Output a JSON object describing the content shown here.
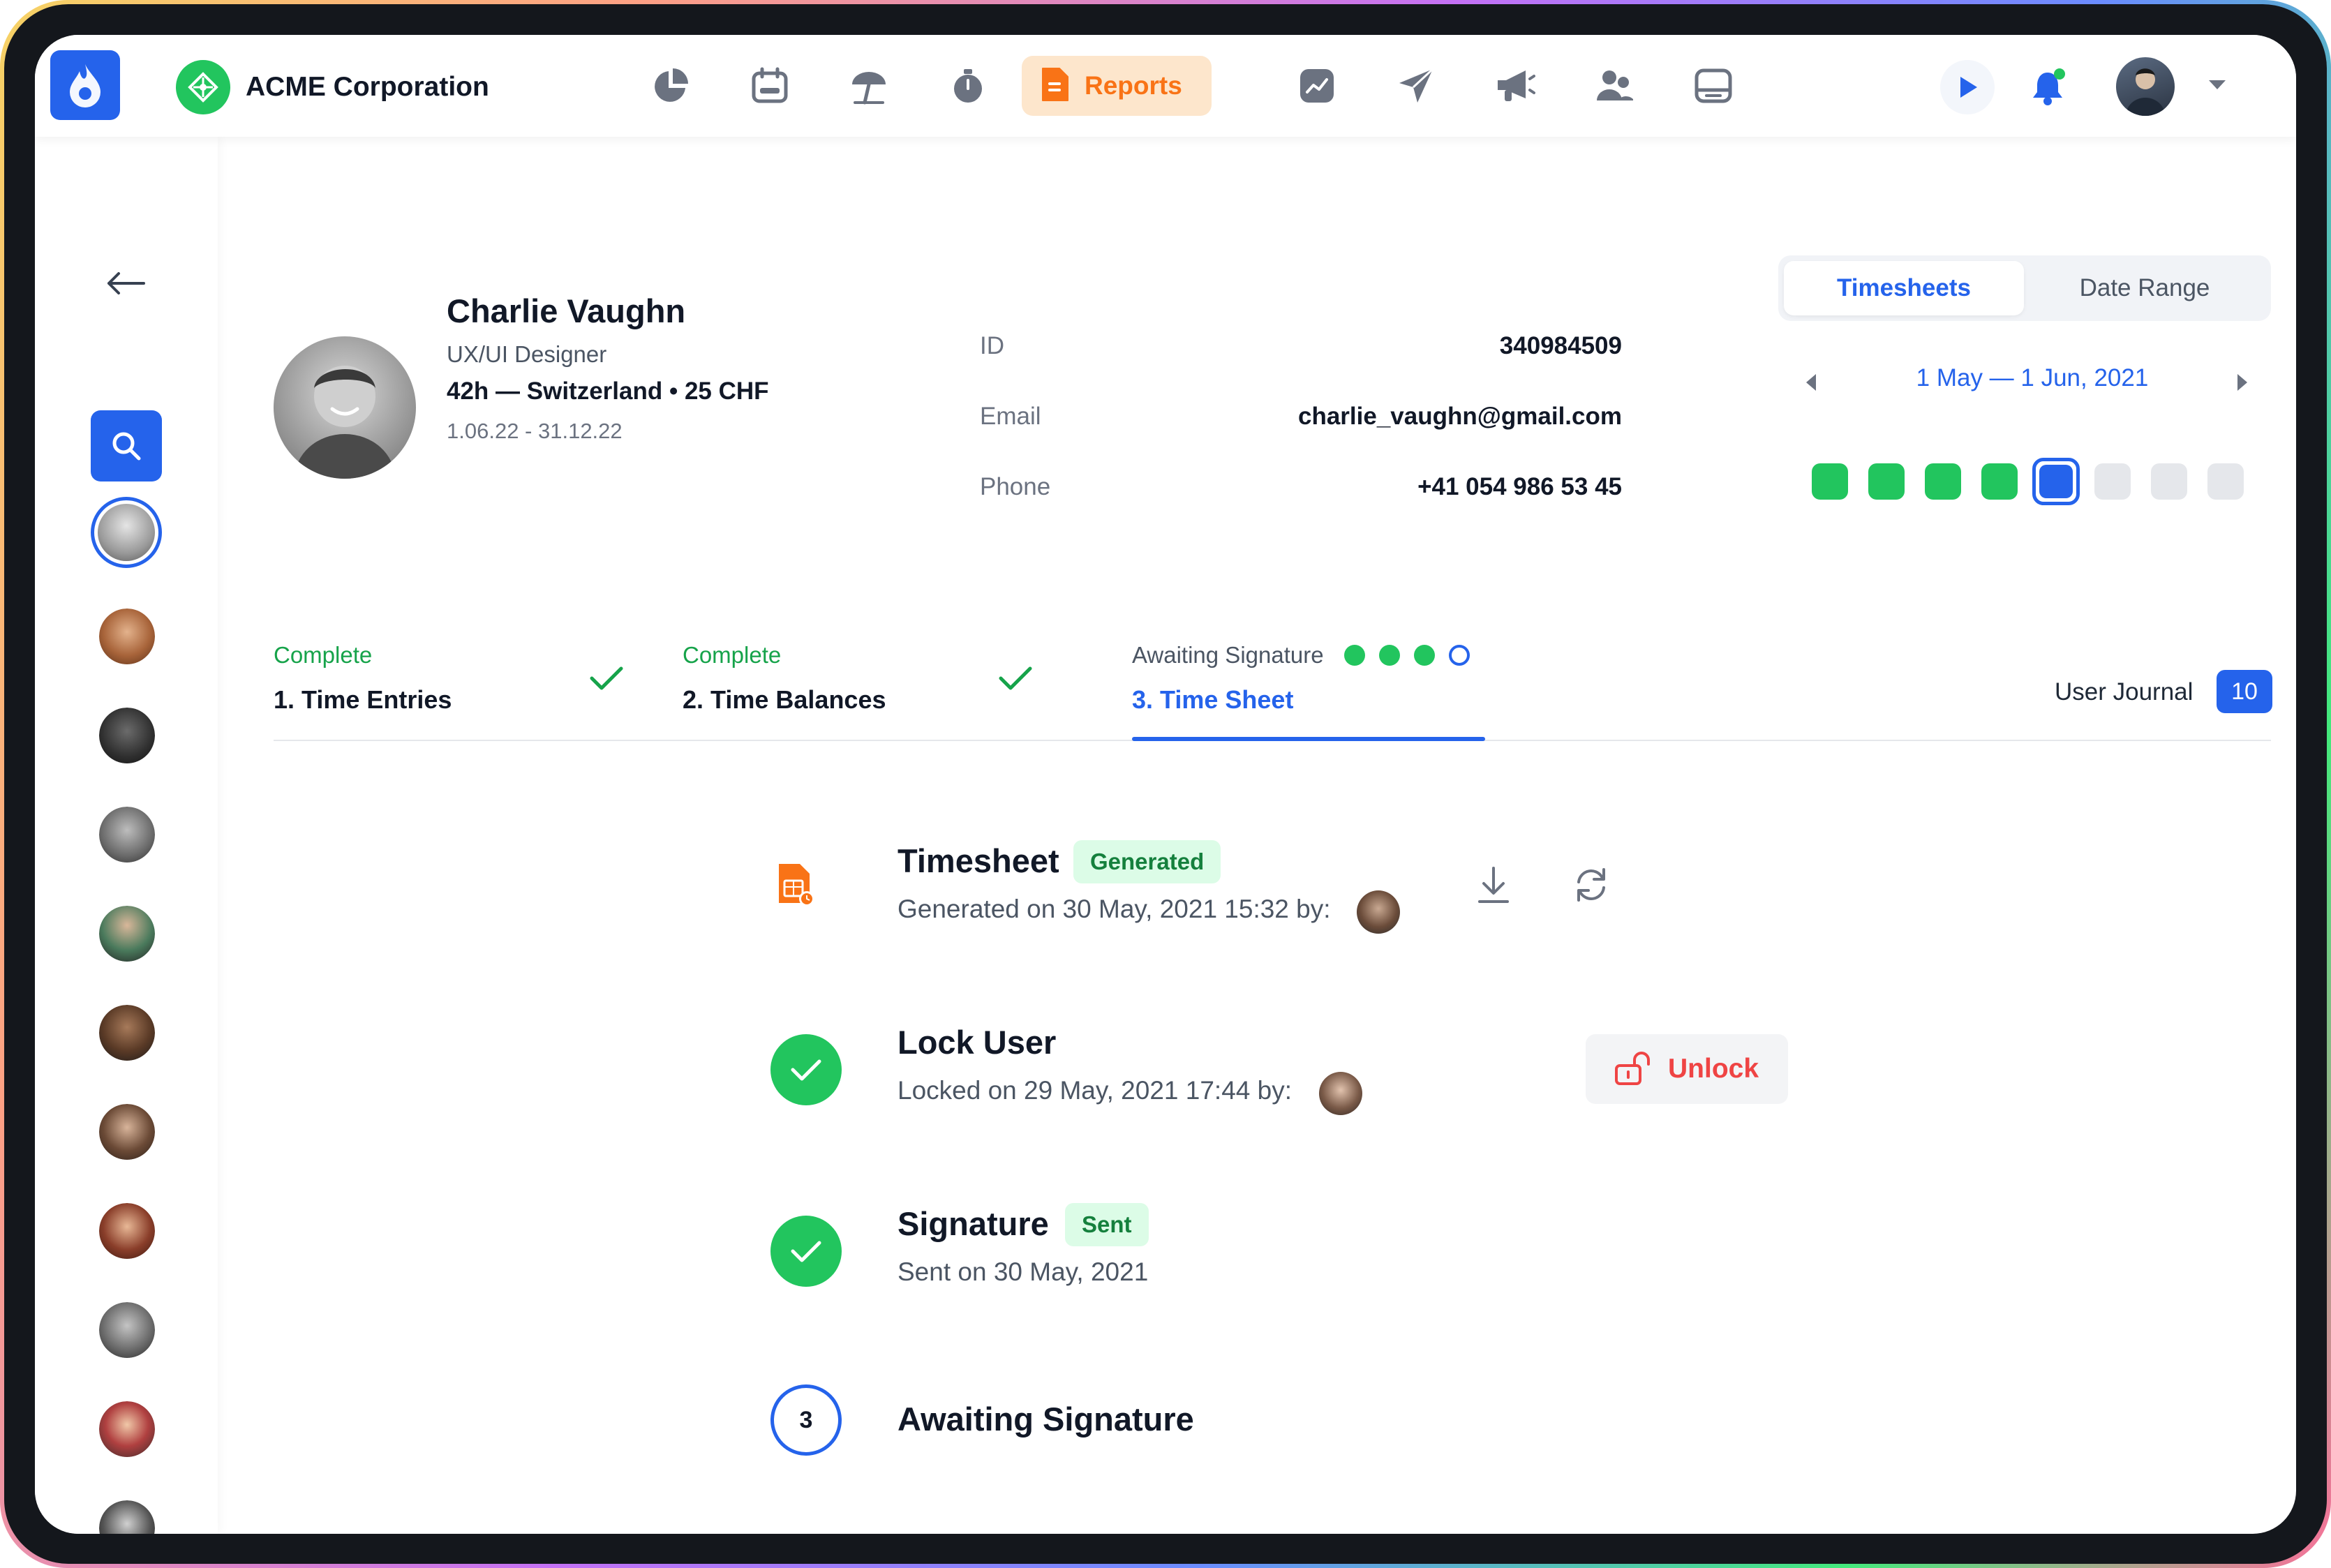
{
  "org": {
    "name": "ACME Corporation"
  },
  "nav": {
    "items": [
      "charts-icon",
      "calendar-icon",
      "vacation-icon",
      "timer-icon",
      "reports-icon",
      "analytics-icon",
      "send-icon",
      "announcements-icon",
      "team-icon",
      "inbox-icon"
    ],
    "active_label": "Reports"
  },
  "colors": {
    "accent": "#2563eb",
    "success": "#22c55e",
    "danger": "#ef4444",
    "reports": "#f97316",
    "inactive": "#e5e7eb"
  },
  "profile": {
    "name": "Charlie Vaughn",
    "role": "UX/UI Designer",
    "hours": "42h — Switzerland • 25 CHF",
    "contract": "1.06.22 - 31.12.22",
    "fields": [
      {
        "label": "ID",
        "value": "340984509"
      },
      {
        "label": "Email",
        "value": "charlie_vaughn@gmail.com"
      },
      {
        "label": "Phone",
        "value": "+41 054 986 53 45"
      }
    ]
  },
  "view_toggle": {
    "active": "Timesheets",
    "other": "Date Range"
  },
  "range": {
    "label": "1 May — 1 Jun, 2021",
    "weeks": [
      "complete",
      "complete",
      "complete",
      "complete",
      "current",
      "pending",
      "pending",
      "pending"
    ]
  },
  "steps": [
    {
      "status": "Complete",
      "title": "1. Time Entries"
    },
    {
      "status": "Complete",
      "title": "2. Time Balances"
    },
    {
      "status": "Awaiting Signature",
      "title": "3. Time Sheet",
      "dots": [
        "done",
        "done",
        "done",
        "pending"
      ]
    }
  ],
  "journal": {
    "label": "User Journal",
    "count": "10"
  },
  "timeline": {
    "timesheet": {
      "title": "Timesheet",
      "badge": "Generated",
      "sub": "Generated on 30 May, 2021 15:32 by:"
    },
    "lock": {
      "title": "Lock User",
      "sub": "Locked on 29 May, 2021  17:44 by:",
      "action": "Unlock"
    },
    "signature": {
      "title": "Signature",
      "badge": "Sent",
      "sub": "Sent on 30 May, 2021"
    },
    "awaiting": {
      "number": "3",
      "title": "Awaiting Signature"
    }
  }
}
